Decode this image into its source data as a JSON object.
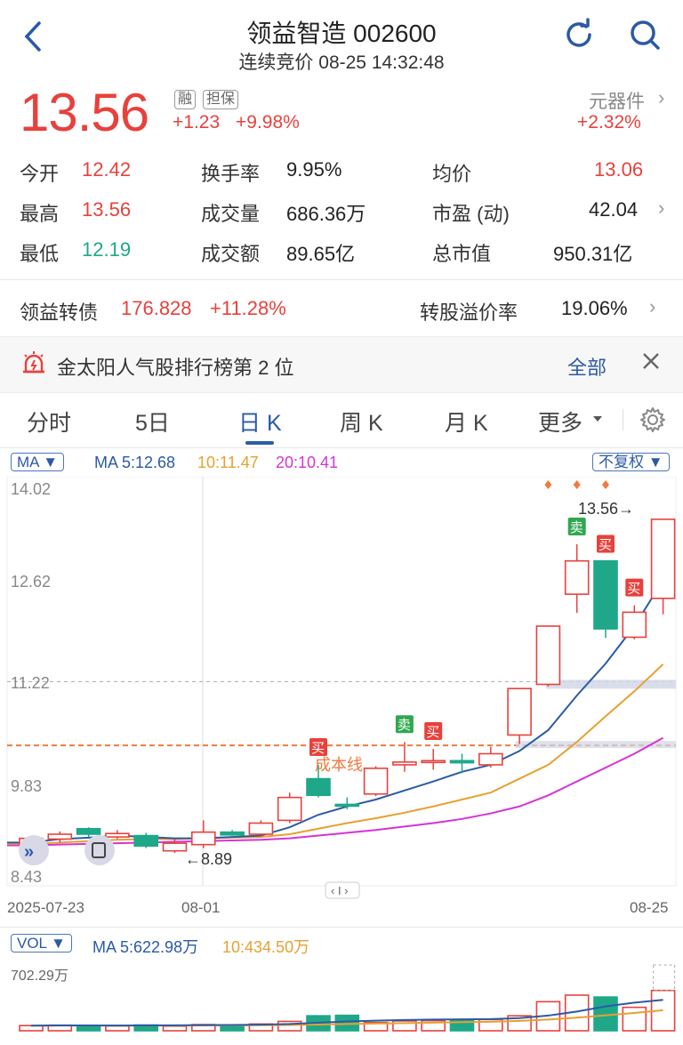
{
  "header": {
    "title": "领益智造 002600",
    "subtitle": "连续竞价 08-25 14:32:48"
  },
  "quote": {
    "price": "13.56",
    "tag1": "融",
    "tag2": "担保",
    "change": "+1.23",
    "change_pct": "+9.98%",
    "sector": "元器件",
    "sector_pct": "+2.32%"
  },
  "stats": {
    "open_l": "今开",
    "open_v": "12.42",
    "turnover_l": "换手率",
    "turnover_v": "9.95%",
    "avg_l": "均价",
    "avg_v": "13.06",
    "high_l": "最高",
    "high_v": "13.56",
    "vol_l": "成交量",
    "vol_v": "686.36万",
    "pe_l": "市盈 (动)",
    "pe_v": "42.04",
    "low_l": "最低",
    "low_v": "12.19",
    "amt_l": "成交额",
    "amt_v": "89.65亿",
    "cap_l": "总市值",
    "cap_v": "950.31亿"
  },
  "bond": {
    "name": "领益转债",
    "price": "176.828",
    "pct": "+11.28%",
    "premium_l": "转股溢价率",
    "premium_v": "19.06%"
  },
  "notice": {
    "text": "金太阳人气股排行榜第 2 位",
    "all": "全部"
  },
  "tabs": [
    "分时",
    "5日",
    "日 K",
    "周 K",
    "月 K",
    "更多"
  ],
  "ma_line": {
    "btn": "MA",
    "ma5": "MA 5:12.68",
    "ma10": "10:11.47",
    "ma20": "20:10.41",
    "adj": "不复权"
  },
  "vol_line": {
    "btn": "VOL",
    "ma5": "MA 5:622.98万",
    "ma10": "10:434.50万",
    "max": "702.29万"
  },
  "annot": {
    "cost": "成本线",
    "low": "←8.89",
    "high": "13.56→",
    "buy": "买",
    "sell": "卖"
  },
  "chart_data": {
    "type": "candlestick",
    "y_ticks": [
      "14.02",
      "12.62",
      "11.22",
      "9.83",
      "8.43"
    ],
    "x_ticks": [
      "2025-07-23",
      "08-01",
      "08-25"
    ],
    "ylim": [
      8.43,
      14.02
    ],
    "candles": [
      {
        "o": 8.87,
        "c": 8.96,
        "h": 8.99,
        "l": 8.84
      },
      {
        "o": 8.95,
        "c": 9.02,
        "h": 9.06,
        "l": 8.9
      },
      {
        "o": 9.1,
        "c": 9.02,
        "h": 9.12,
        "l": 8.98
      },
      {
        "o": 8.98,
        "c": 9.03,
        "h": 9.08,
        "l": 8.95
      },
      {
        "o": 9.0,
        "c": 8.85,
        "h": 9.04,
        "l": 8.82
      },
      {
        "o": 8.78,
        "c": 8.89,
        "h": 8.95,
        "l": 8.75
      },
      {
        "o": 8.87,
        "c": 9.05,
        "h": 9.22,
        "l": 8.82
      },
      {
        "o": 9.05,
        "c": 9.01,
        "h": 9.08,
        "l": 8.98
      },
      {
        "o": 9.02,
        "c": 9.18,
        "h": 9.22,
        "l": 9.0
      },
      {
        "o": 9.22,
        "c": 9.55,
        "h": 9.62,
        "l": 9.18
      },
      {
        "o": 9.82,
        "c": 9.58,
        "h": 10.02,
        "l": 9.55
      },
      {
        "o": 9.45,
        "c": 9.43,
        "h": 9.55,
        "l": 9.38
      },
      {
        "o": 9.6,
        "c": 9.97,
        "h": 10.0,
        "l": 9.57
      },
      {
        "o": 10.02,
        "c": 10.06,
        "h": 10.35,
        "l": 9.92
      },
      {
        "o": 10.06,
        "c": 10.08,
        "h": 10.25,
        "l": 9.95
      },
      {
        "o": 10.08,
        "c": 10.05,
        "h": 10.18,
        "l": 9.9
      },
      {
        "o": 10.02,
        "c": 10.18,
        "h": 10.28,
        "l": 9.98
      },
      {
        "o": 10.45,
        "c": 11.12,
        "h": 11.12,
        "l": 10.32
      },
      {
        "o": 11.18,
        "c": 12.02,
        "h": 12.02,
        "l": 11.15
      },
      {
        "o": 12.48,
        "c": 12.96,
        "h": 13.2,
        "l": 12.21
      },
      {
        "o": 12.96,
        "c": 11.98,
        "h": 12.95,
        "l": 11.85
      },
      {
        "o": 11.86,
        "c": 12.22,
        "h": 12.32,
        "l": 11.83
      },
      {
        "o": 12.42,
        "c": 13.56,
        "h": 13.56,
        "l": 12.19
      }
    ],
    "ma5": [
      8.9,
      8.95,
      8.97,
      9.0,
      8.98,
      8.96,
      8.96,
      8.98,
      9.0,
      9.12,
      9.3,
      9.42,
      9.52,
      9.65,
      9.78,
      9.92,
      10.02,
      10.22,
      10.52,
      11.02,
      11.48,
      12.02,
      12.68
    ],
    "ma10": [
      8.88,
      8.9,
      8.92,
      8.94,
      8.95,
      8.95,
      8.96,
      8.97,
      8.98,
      9.02,
      9.1,
      9.18,
      9.25,
      9.33,
      9.42,
      9.52,
      9.62,
      9.82,
      10.02,
      10.35,
      10.72,
      11.08,
      11.47
    ],
    "ma20": [
      8.86,
      8.87,
      8.88,
      8.89,
      8.9,
      8.91,
      8.92,
      8.93,
      8.94,
      8.96,
      9.0,
      9.04,
      9.08,
      9.13,
      9.18,
      9.24,
      9.32,
      9.42,
      9.58,
      9.78,
      9.98,
      10.18,
      10.41
    ],
    "cost_line": 10.3,
    "ref_line": 11.22,
    "buy_marks": [
      10,
      14,
      20,
      21
    ],
    "sell_marks": [
      13,
      19
    ],
    "volume": [
      55,
      60,
      58,
      52,
      62,
      50,
      66,
      60,
      72,
      100,
      160,
      165,
      88,
      105,
      108,
      115,
      120,
      160,
      310,
      380,
      360,
      250,
      430
    ],
    "vol_ma5": [
      55,
      57,
      57,
      56,
      57,
      58,
      60,
      62,
      65,
      72,
      86,
      100,
      108,
      115,
      120,
      122,
      125,
      135,
      162,
      205,
      260,
      300,
      330
    ],
    "vol_ma10": [
      55,
      56,
      56,
      56,
      56,
      56,
      57,
      58,
      59,
      62,
      67,
      72,
      77,
      82,
      87,
      92,
      96,
      105,
      120,
      140,
      165,
      190,
      220
    ],
    "vol_max": 702.29
  }
}
